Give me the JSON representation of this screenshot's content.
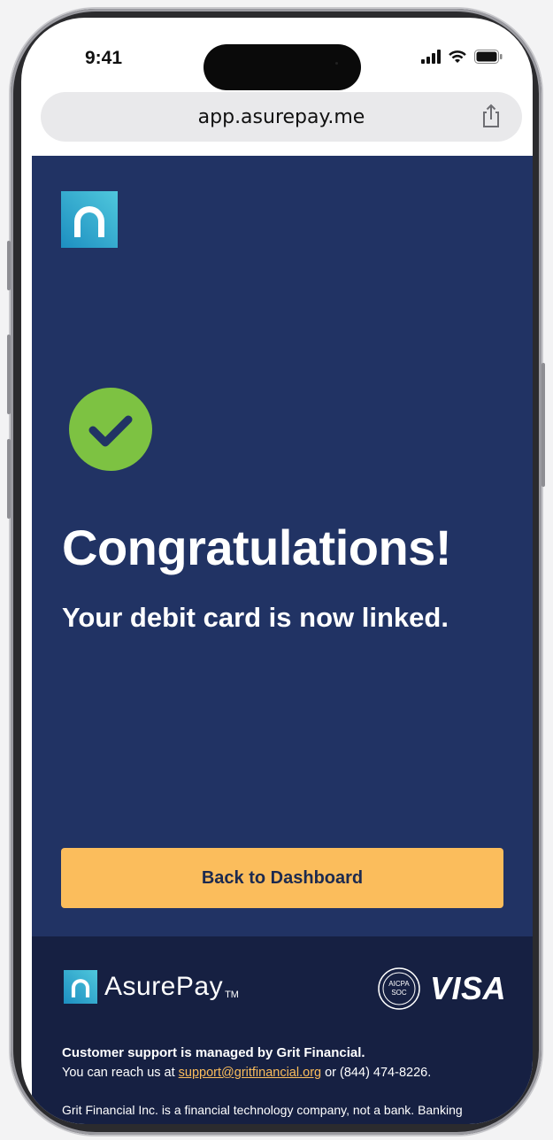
{
  "status_bar": {
    "time": "9:41"
  },
  "browser": {
    "url": "app.asurepay.me"
  },
  "main": {
    "title": "Congratulations!",
    "subtitle": "Your debit card is now linked.",
    "cta_label": "Back to Dashboard"
  },
  "footer": {
    "brand_name": "AsurePay",
    "brand_tm": "TM",
    "badge_line1": "AICPA",
    "badge_line2": "SOC",
    "visa": "VISA",
    "support_title": "Customer support is managed by Grit Financial.",
    "support_prefix": "You can reach us at ",
    "support_email": "support@gritfinancial.org",
    "support_suffix": " or (844) 474-8226.",
    "disclaimer": "Grit Financial Inc. is a financial technology company, not a bank. Banking"
  },
  "colors": {
    "content_bg": "#213364",
    "footer_bg": "#162042",
    "cta_bg": "#fbbd5c",
    "check_green": "#7dc242"
  }
}
